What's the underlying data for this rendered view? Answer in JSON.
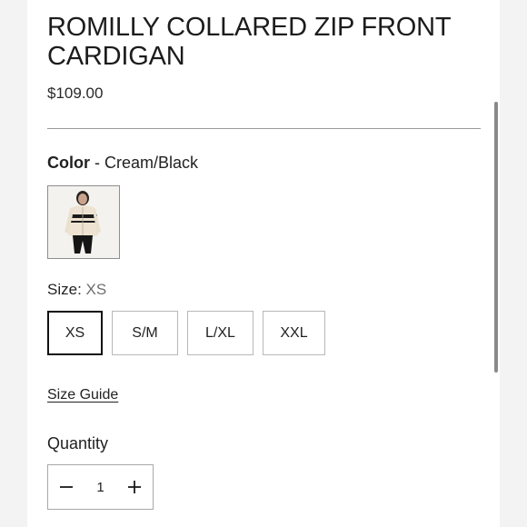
{
  "product": {
    "title": "ROMILLY COLLARED ZIP FRONT CARDIGAN",
    "price": "$109.00"
  },
  "color": {
    "label": "Color",
    "separator": " - ",
    "value": "Cream/Black",
    "swatch_icon": "product-thumbnail-image"
  },
  "size": {
    "label": "Size:",
    "selected": "XS",
    "options": [
      "XS",
      "S/M",
      "L/XL",
      "XXL"
    ]
  },
  "size_guide": "Size Guide",
  "quantity": {
    "label": "Quantity",
    "value": "1",
    "decrement_icon": "minus-icon",
    "increment_icon": "plus-icon"
  },
  "colors": {
    "accent": "#111111",
    "border": "#b8b8b8"
  }
}
